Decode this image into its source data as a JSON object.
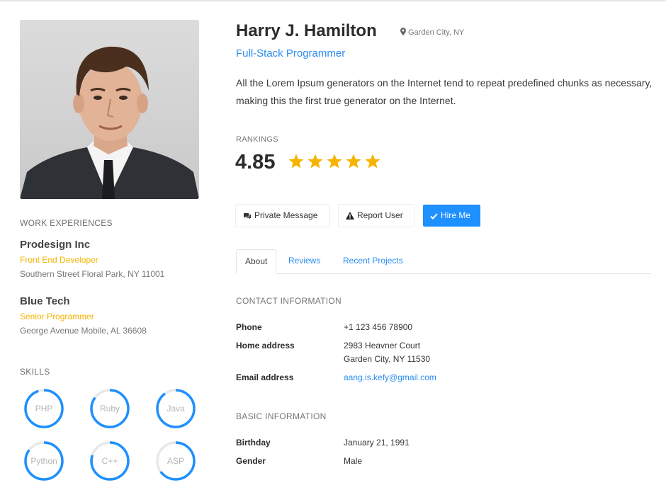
{
  "profile": {
    "name": "Harry J. Hamilton",
    "location": "Garden City, NY",
    "title": "Full-Stack Programmer",
    "bio": "All the Lorem Ipsum generators on the Internet tend to repeat predefined chunks as necessary, making this the first true generator on the Internet."
  },
  "rankings": {
    "label": "RANKINGS",
    "value": "4.85",
    "stars_filled": 5,
    "stars_total": 5,
    "star_color": "#f4b400"
  },
  "work": {
    "label": "WORK EXPERIENCES",
    "items": [
      {
        "company": "Prodesign Inc",
        "role": "Front End Developer",
        "address": "Southern Street Floral Park, NY 11001"
      },
      {
        "company": "Blue Tech",
        "role": "Senior Programmer",
        "address": "George Avenue Mobile, AL 36608"
      }
    ]
  },
  "skills": {
    "label": "SKILLS",
    "items": [
      {
        "name": "PHP",
        "level": 0.95
      },
      {
        "name": "Ruby",
        "level": 0.85
      },
      {
        "name": "Java",
        "level": 0.9
      },
      {
        "name": "Python",
        "level": 0.85
      },
      {
        "name": "C++",
        "level": 0.8
      },
      {
        "name": "ASP",
        "level": 0.65
      }
    ],
    "ring_color": "#1e90ff",
    "track_color": "#e8e8e8"
  },
  "actions": {
    "message": "Private Message",
    "report": "Report User",
    "hire": "Hire Me"
  },
  "tabs": [
    "About",
    "Reviews",
    "Recent Projects"
  ],
  "contact": {
    "label": "CONTACT INFORMATION",
    "phone_key": "Phone",
    "phone": "+1 123 456 78900",
    "address_key": "Home address",
    "address_line1": "2983 Heavner Court",
    "address_line2": "Garden City, NY 11530",
    "email_key": "Email address",
    "email": "aang.is.kefy@gmail.com"
  },
  "basic": {
    "label": "BASIC INFORMATION",
    "birthday_key": "Birthday",
    "birthday": "January 21, 1991",
    "gender_key": "Gender",
    "gender": "Male"
  },
  "colors": {
    "accent": "#1e90ff",
    "link": "#2b8df2",
    "role": "#f4b400"
  }
}
